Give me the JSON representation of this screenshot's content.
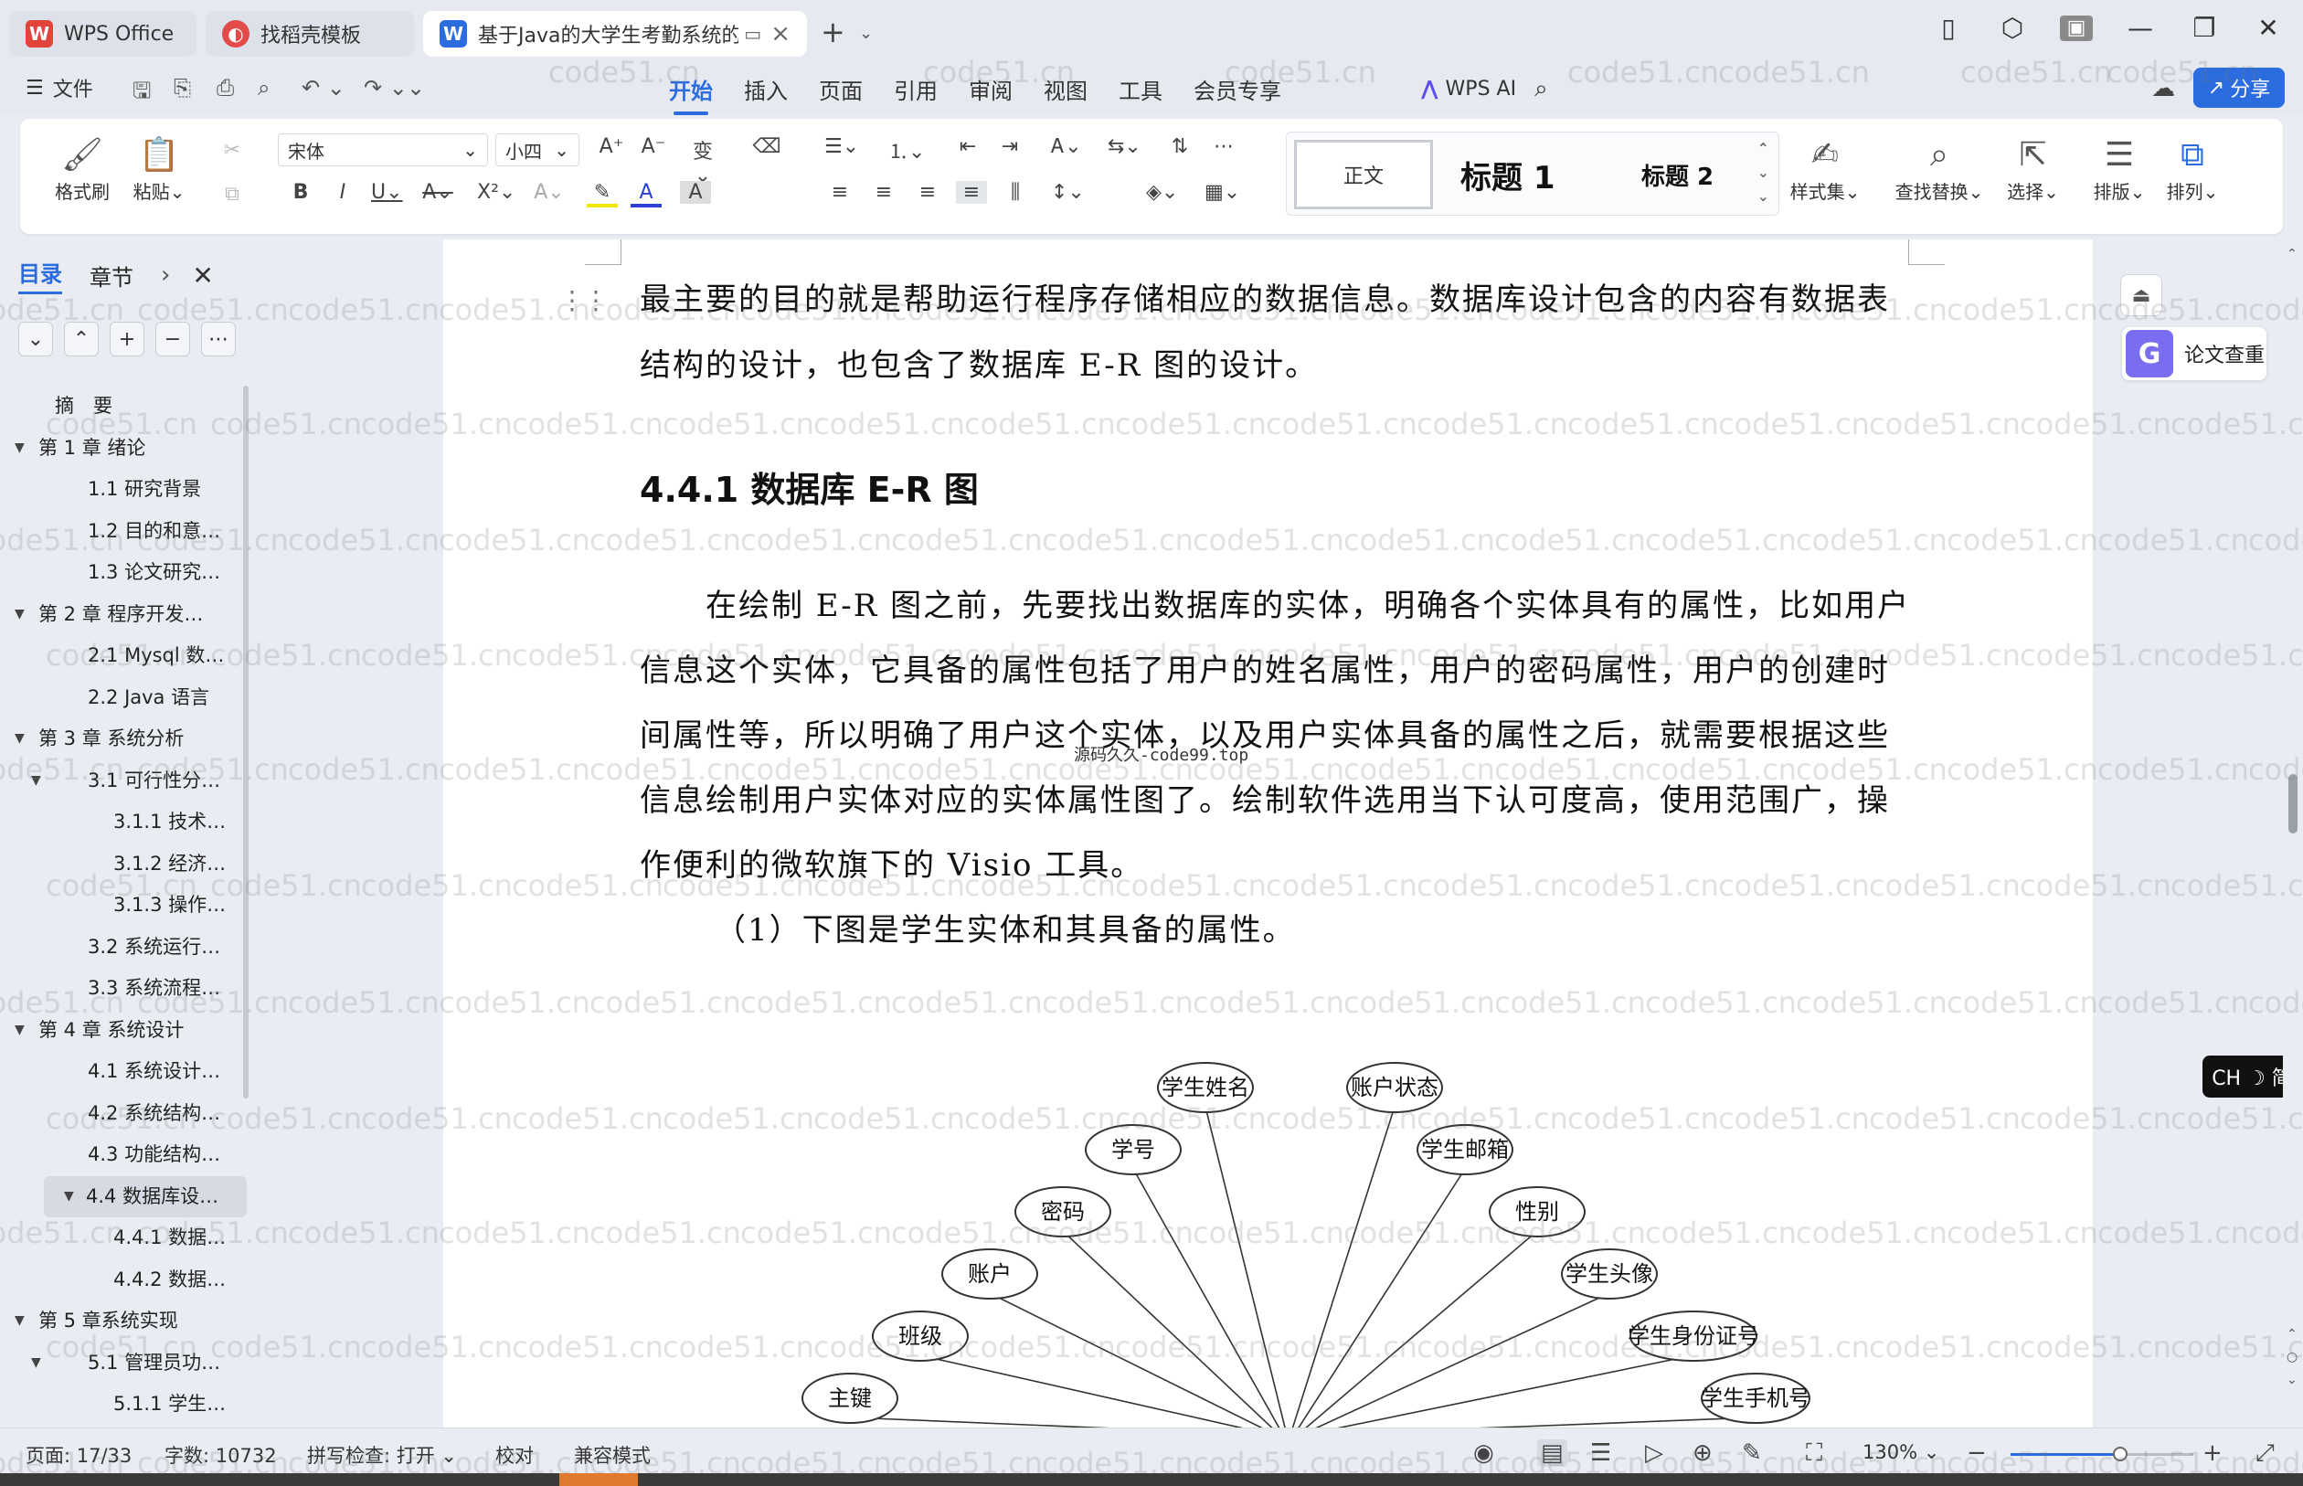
{
  "tabs": [
    {
      "label": "WPS Office"
    },
    {
      "label": "找稻壳模板"
    },
    {
      "label": "基于Java的大学生考勤系统的设"
    }
  ],
  "menu": {
    "file": "文件",
    "tabs": [
      "开始",
      "插入",
      "页面",
      "引用",
      "审阅",
      "视图",
      "工具",
      "会员专享"
    ],
    "wps_ai": "WPS AI",
    "share": "分享"
  },
  "ribbon": {
    "format_painter": "格式刷",
    "paste": "粘贴",
    "font_name": "宋体",
    "font_size": "小四",
    "style_normal": "正文",
    "style_h1": "标题 1",
    "style_h2": "标题 2",
    "style_set": "样式集",
    "find_replace": "查找替换",
    "select": "选择",
    "layout": "排版",
    "arrange": "排列"
  },
  "nav": {
    "tab_toc": "目录",
    "tab_chapter": "章节",
    "items": [
      {
        "label": "摘　要",
        "level": 0,
        "arrow": ""
      },
      {
        "label": "第 1 章  绪论",
        "level": 0,
        "arrow": "▼"
      },
      {
        "label": "1.1  研究背景",
        "level": 1,
        "arrow": ""
      },
      {
        "label": "1.2 目的和意…",
        "level": 1,
        "arrow": ""
      },
      {
        "label": "1.3  论文研究…",
        "level": 1,
        "arrow": ""
      },
      {
        "label": "第 2 章  程序开发…",
        "level": 0,
        "arrow": "▼"
      },
      {
        "label": "2.1 Mysql 数…",
        "level": 1,
        "arrow": ""
      },
      {
        "label": "2.2 Java 语言",
        "level": 1,
        "arrow": ""
      },
      {
        "label": "第 3 章  系统分析",
        "level": 0,
        "arrow": "▼"
      },
      {
        "label": "3.1 可行性分…",
        "level": 1,
        "arrow": "▼"
      },
      {
        "label": "3.1.1 技术…",
        "level": 2,
        "arrow": ""
      },
      {
        "label": "3.1.2 经济…",
        "level": 2,
        "arrow": ""
      },
      {
        "label": "3.1.3 操作…",
        "level": 2,
        "arrow": ""
      },
      {
        "label": "3.2 系统运行…",
        "level": 1,
        "arrow": ""
      },
      {
        "label": "3.3 系统流程…",
        "level": 1,
        "arrow": ""
      },
      {
        "label": "第 4 章  系统设计",
        "level": 0,
        "arrow": "▼"
      },
      {
        "label": "4.1  系统设计…",
        "level": 1,
        "arrow": ""
      },
      {
        "label": "4.2  系统结构…",
        "level": 1,
        "arrow": ""
      },
      {
        "label": "4.3 功能结构…",
        "level": 1,
        "arrow": ""
      },
      {
        "label": "4.4 数据库设…",
        "level": 1,
        "arrow": "▼",
        "selected": true
      },
      {
        "label": "4.4.1  数据…",
        "level": 2,
        "arrow": ""
      },
      {
        "label": "4.4.2  数据…",
        "level": 2,
        "arrow": ""
      },
      {
        "label": "第 5 章系统实现",
        "level": 0,
        "arrow": "▼"
      },
      {
        "label": "5.1 管理员功…",
        "level": 1,
        "arrow": "▼"
      },
      {
        "label": "5.1.1  学生…",
        "level": 2,
        "arrow": ""
      }
    ]
  },
  "doc": {
    "para1_line1": "最主要的目的就是帮助运行程序存储相应的数据信息。数据库设计包含的内容有数据表",
    "para1_line2": "结构的设计，也包含了数据库 E-R 图的设计。",
    "heading": "4.4.1  数据库 E-R 图",
    "para2_line1": "在绘制 E-R 图之前，先要找出数据库的实体，明确各个实体具有的属性，比如用户",
    "para2_line2": "信息这个实体，它具备的属性包括了用户的姓名属性，用户的密码属性，用户的创建时",
    "para2_line3": "间属性等，所以明确了用户这个实体，以及用户实体具备的属性之后，就需要根据这些",
    "para2_line4": "信息绘制用户实体对应的实体属性图了。绘制软件选用当下认可度高，使用范围广，操",
    "para2_line5": "作便利的微软旗下的 Visio 工具。",
    "para3": "（1）下图是学生实体和其具备的属性。",
    "source_mark": "源码久久-code99.top",
    "er_attributes": [
      "主键",
      "班级",
      "账户",
      "密码",
      "学号",
      "学生姓名",
      "账户状态",
      "学生邮箱",
      "性别",
      "学生头像",
      "学生身份证号",
      "学生手机号"
    ]
  },
  "right": {
    "plagiarism": "论文查重",
    "ime": "CH ☽ 简"
  },
  "status": {
    "page": "页面: 17/33",
    "words": "字数: 10732",
    "spell": "拼写检查: 打开",
    "proof": "校对",
    "compat": "兼容模式",
    "zoom": "130%",
    "zoom_level": 0.3
  },
  "watermark": "code51.cn",
  "colors": {
    "accent": "#2b6cde",
    "wps_red": "#e0443a",
    "daoke": "#e34b4b"
  }
}
